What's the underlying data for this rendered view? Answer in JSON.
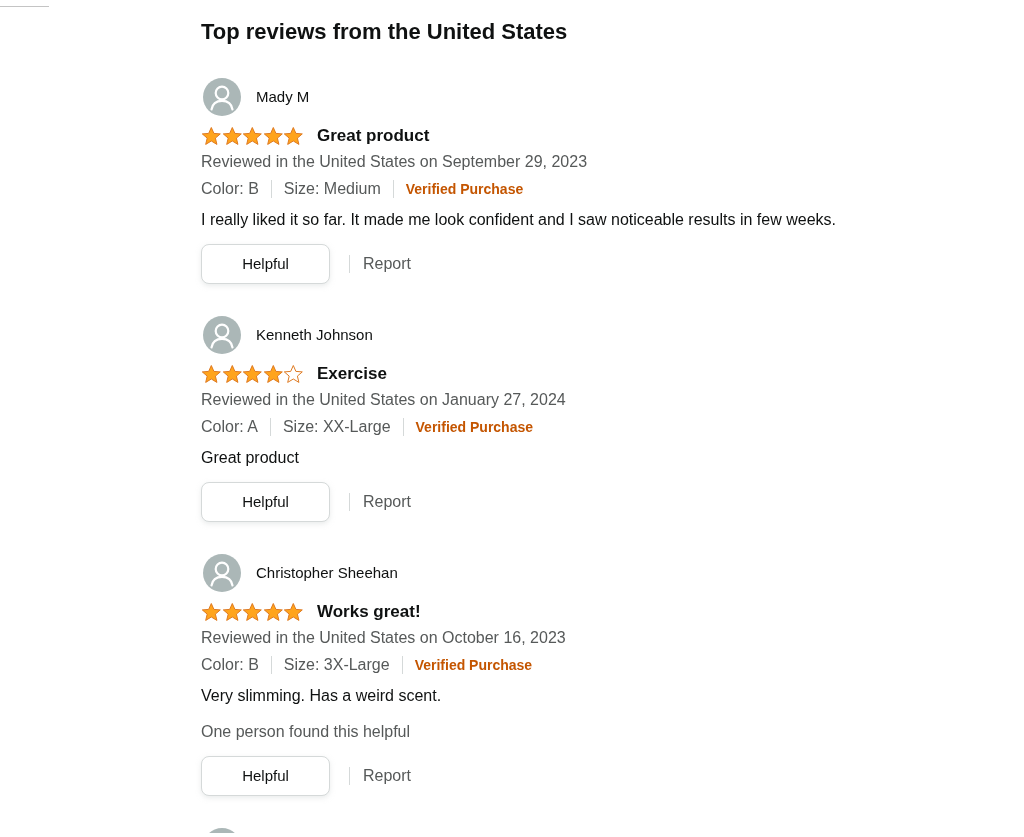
{
  "heading": "Top reviews from the United States",
  "reviews": [
    {
      "reviewer": "Mady M",
      "stars": 5,
      "title": "Great product",
      "date_line": "Reviewed in the United States on September 29, 2023",
      "variants": [
        "Color: B",
        "Size: Medium"
      ],
      "badge": "Verified Purchase",
      "body": "I really liked it so far. It made me look confident and I saw noticeable results in few weeks.",
      "helpful_button": "Helpful",
      "report_link": "Report"
    },
    {
      "reviewer": "Kenneth Johnson",
      "stars": 4,
      "title": "Exercise",
      "date_line": "Reviewed in the United States on January 27, 2024",
      "variants": [
        "Color: A",
        "Size: XX-Large"
      ],
      "badge": "Verified Purchase",
      "body": "Great product",
      "helpful_button": "Helpful",
      "report_link": "Report"
    },
    {
      "reviewer": "Christopher Sheehan",
      "stars": 5,
      "title": "Works great!",
      "date_line": "Reviewed in the United States on October 16, 2023",
      "variants": [
        "Color: B",
        "Size: 3X-Large"
      ],
      "badge": "Verified Purchase",
      "body": "Very slimming. Has a weird scent.",
      "helpful_count": "One person found this helpful",
      "helpful_button": "Helpful",
      "report_link": "Report"
    }
  ],
  "next_review_avatar": true
}
